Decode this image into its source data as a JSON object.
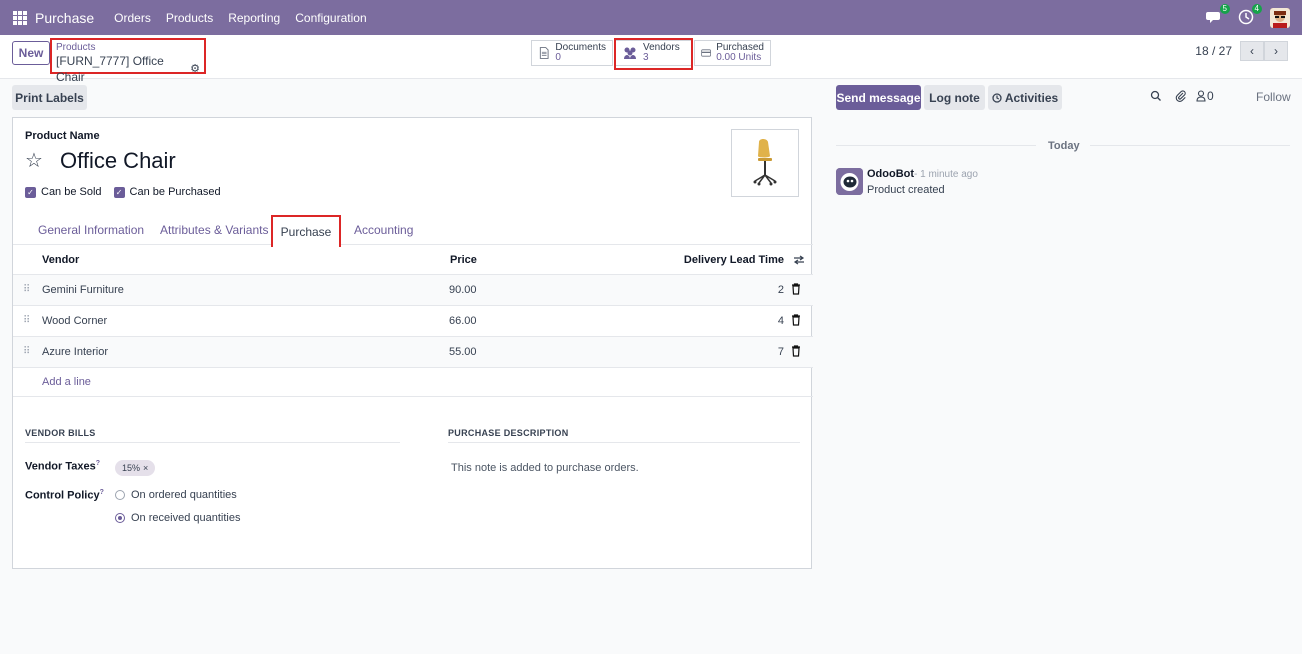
{
  "navbar": {
    "app_name": "Purchase",
    "menu": [
      "Orders",
      "Products",
      "Reporting",
      "Configuration"
    ],
    "messages_count": "5",
    "activities_count": "4"
  },
  "control_panel": {
    "new_label": "New",
    "breadcrumb_parent": "Products",
    "breadcrumb_current": "[FURN_7777] Office Chair",
    "smart_buttons": [
      {
        "label": "Documents",
        "value": "0"
      },
      {
        "label": "Vendors",
        "value": "3"
      },
      {
        "label": "Purchased",
        "value": "0.00 Units"
      }
    ],
    "pager": "18 / 27"
  },
  "toolbar": {
    "print_labels": "Print Labels"
  },
  "form": {
    "product_name_label": "Product Name",
    "product_name": "Office Chair",
    "can_be_sold": "Can be Sold",
    "can_be_purchased": "Can be Purchased",
    "tabs": [
      "General Information",
      "Attributes & Variants",
      "Purchase",
      "Accounting"
    ],
    "active_tab": "Purchase",
    "vendor_table": {
      "headers": {
        "vendor": "Vendor",
        "price": "Price",
        "lead_time": "Delivery Lead Time"
      },
      "rows": [
        {
          "vendor": "Gemini Furniture",
          "price": "90.00",
          "lead_time": "2"
        },
        {
          "vendor": "Wood Corner",
          "price": "66.00",
          "lead_time": "4"
        },
        {
          "vendor": "Azure Interior",
          "price": "55.00",
          "lead_time": "7"
        }
      ],
      "add_line": "Add a line"
    },
    "vendor_bills_title": "VENDOR BILLS",
    "vendor_taxes_label": "Vendor Taxes",
    "vendor_taxes_tag": "15%",
    "control_policy_label": "Control Policy",
    "control_policy_options": [
      "On ordered quantities",
      "On received quantities"
    ],
    "purchase_description_title": "PURCHASE DESCRIPTION",
    "purchase_description_text": "This note is added to purchase orders."
  },
  "chatter": {
    "send_message": "Send message",
    "log_note": "Log note",
    "activities": "Activities",
    "followers_count": "0",
    "follow": "Follow",
    "date_separator": "Today",
    "message": {
      "author": "OdooBot",
      "time": "- 1 minute ago",
      "body": "Product created"
    }
  },
  "colors": {
    "brand": "#7c6d9f",
    "accent": "#6b5d99",
    "highlight": "#dc2626"
  }
}
